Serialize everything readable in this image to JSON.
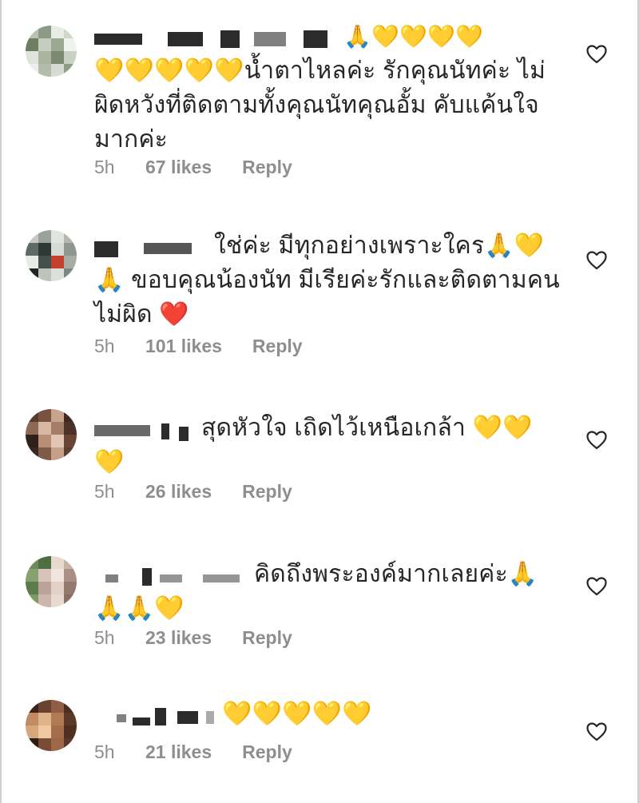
{
  "comments": [
    {
      "text_lines": [
        "🙏💛💛💛💛",
        "💛💛💛💛💛น้ำตาไหลค่ะ รักคุณนัทค่ะ ไม่",
        "ผิดหวังที่ติดตามทั้งคุณนัทคุณอั้ม คับแค้นใจ",
        "มากค่ะ"
      ],
      "time": "5h",
      "likes": "67 likes",
      "reply_label": "Reply",
      "avatar_colors": [
        "#b9c2b3",
        "#8d9a86",
        "#e8ece4",
        "#cfd6cb",
        "#6f7d63",
        "#c4cdbf",
        "#9ba893",
        "#f0f2ee",
        "#dfe4da",
        "#a9b5a0",
        "#7d8b72",
        "#c9d1c3",
        "#edf0ea",
        "#b2bdab",
        "#d7ddd2",
        "#8f9c85"
      ]
    },
    {
      "text_lines": [
        "ใช่ค่ะ มีทุกอย่างเพราะใคร🙏💛",
        "🙏 ขอบคุณน้องนัท มีเรียค่ะรักและติดตามคน",
        "ไม่ผิด ❤️"
      ],
      "time": "5h",
      "likes": "101 likes",
      "reply_label": "Reply",
      "avatar_colors": [
        "#c7c9c4",
        "#9aa29c",
        "#e2e4df",
        "#b4b8b1",
        "#5d6a66",
        "#2f3a36",
        "#d8dad5",
        "#8f9690",
        "#e9ebe6",
        "#44504c",
        "#c2412f",
        "#a8aea6",
        "#1e2522",
        "#bfc3bc",
        "#dde0da",
        "#7e8680"
      ]
    },
    {
      "text_lines": [
        "สุดหัวใจ เถิดไว้เหนือเกล้า 💛💛",
        "💛"
      ],
      "time": "5h",
      "likes": "26 likes",
      "reply_label": "Reply",
      "avatar_colors": [
        "#5a3a2e",
        "#7b5242",
        "#c8a38d",
        "#3e2a22",
        "#8e6a56",
        "#d7b8a3",
        "#a37d66",
        "#4b3228",
        "#2f201a",
        "#b99077",
        "#e2c7b4",
        "#6a4536",
        "#3a2720",
        "#7f5a48",
        "#c69f88",
        "#5c3d30"
      ]
    },
    {
      "text_lines": [
        "คิดถึงพระองค์มากเลยค่ะ🙏",
        "🙏🙏💛"
      ],
      "time": "5h",
      "likes": "23 likes",
      "reply_label": "Reply",
      "avatar_colors": [
        "#6d8c5a",
        "#4f6d43",
        "#e8d9cf",
        "#c9b2a6",
        "#87a270",
        "#d8c3b8",
        "#f0e6df",
        "#a98f86",
        "#5d7c4c",
        "#bca297",
        "#e3d1c7",
        "#94796f",
        "#7c9864",
        "#cdb6ab",
        "#ead9d0",
        "#8a6f66"
      ]
    },
    {
      "text_lines": [
        "💛💛💛💛💛"
      ],
      "time": "5h",
      "likes": "21 likes",
      "reply_label": "Reply",
      "avatar_colors": [
        "#3b2418",
        "#6a4330",
        "#8f5e43",
        "#4a2e20",
        "#c08b64",
        "#e0b48b",
        "#b07a55",
        "#5c3827",
        "#d6a67c",
        "#f0c9a2",
        "#a46d4c",
        "#4e3022",
        "#2e1b12",
        "#7a4c35",
        "#9c684a",
        "#5a3626"
      ]
    }
  ],
  "colors": {
    "text": "#262626",
    "meta": "#8e8e8e",
    "heart_outline": "#262626"
  },
  "icons": {
    "like": "heart-outline-icon"
  }
}
